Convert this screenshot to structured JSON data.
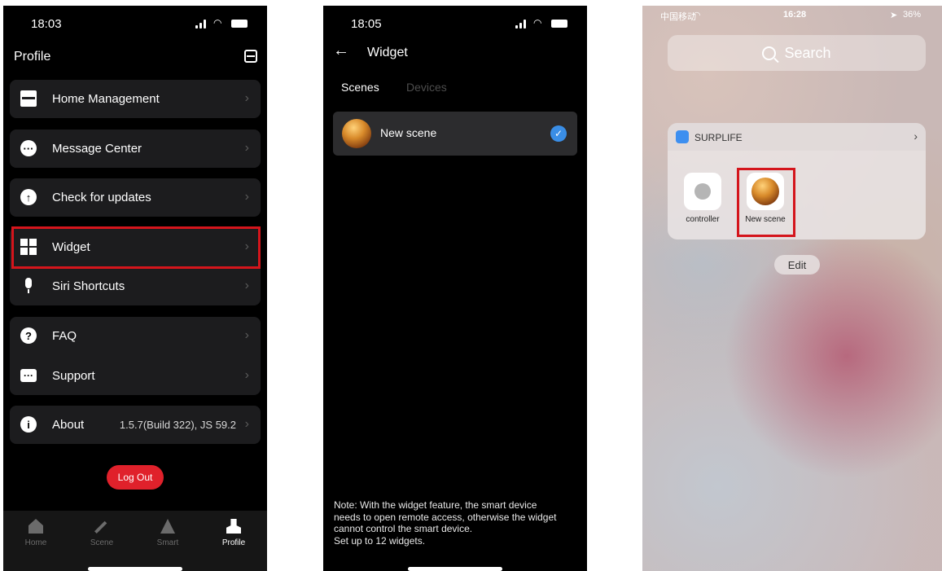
{
  "profile": {
    "status_time": "18:03",
    "title": "Profile",
    "menu": [
      {
        "label": "Home Management",
        "value": ""
      },
      {
        "label": "Message Center",
        "value": ""
      },
      {
        "label": "Check for updates",
        "value": ""
      },
      {
        "label": "Widget",
        "value": ""
      },
      {
        "label": "Siri Shortcuts",
        "value": ""
      },
      {
        "label": "FAQ",
        "value": ""
      },
      {
        "label": "Support",
        "value": ""
      },
      {
        "label": "About",
        "value": "1.5.7(Build 322), JS 59.2"
      }
    ],
    "logout_label": "Log Out",
    "tabs": [
      "Home",
      "Scene",
      "Smart",
      "Profile"
    ],
    "highlight_color": "#d4151c"
  },
  "widget_screen": {
    "status_time": "18:05",
    "title": "Widget",
    "tabs": [
      "Scenes",
      "Devices"
    ],
    "scene_name": "New scene",
    "note_lines": [
      "Note: With the widget feature, the smart device",
      "needs to open remote access, otherwise the widget",
      "cannot control the smart device.",
      "Set up to 12 widgets."
    ]
  },
  "ios_screen": {
    "carrier": "中国移动",
    "status_time": "16:28",
    "battery": "36%",
    "search_placeholder": "Search",
    "app_name": "SURPLIFE",
    "items": [
      "controller",
      "New scene"
    ],
    "edit_label": "Edit"
  }
}
